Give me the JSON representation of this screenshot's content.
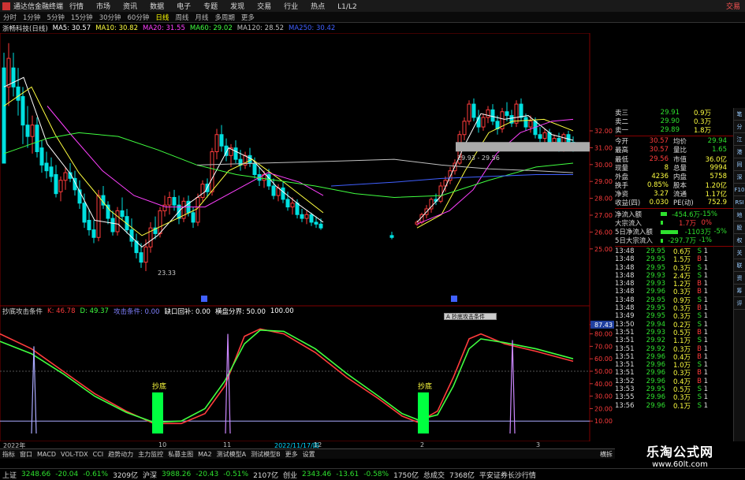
{
  "titlebar": {
    "app_name": "通达信金融终端",
    "menu": [
      "行情",
      "市场",
      "资讯",
      "数据",
      "电子",
      "专题",
      "发现",
      "交易",
      "行业",
      "热点",
      "L1/L2"
    ],
    "right_text": "交易"
  },
  "periodbar": {
    "items": [
      "分时",
      "1分钟",
      "5分钟",
      "15分钟",
      "30分钟",
      "60分钟",
      "日线",
      "周线",
      "月线",
      "多周期",
      "更多"
    ],
    "active": "日线"
  },
  "ma_legend": {
    "stock": "浙畅科技(日线)",
    "items": [
      {
        "text": "MA5: 30.57",
        "color": "#ffffff"
      },
      {
        "text": "MA10: 30.82",
        "color": "#ffff40"
      },
      {
        "text": "MA20: 31.55",
        "color": "#ff40ff"
      },
      {
        "text": "MA60: 29.02",
        "color": "#40ff40"
      },
      {
        "text": "MA120: 28.52",
        "color": "#c0c0c0"
      },
      {
        "text": "MA250: 30.42",
        "color": "#4060ff"
      }
    ]
  },
  "price_axis": [
    "32.00",
    "31.00",
    "30.00",
    "29.00",
    "28.00",
    "27.00",
    "26.00",
    "25.00"
  ],
  "price_labels": {
    "low": "23.33",
    "range": "29.93 - 29.56"
  },
  "ind_legend": {
    "name": "抄底攻击条件",
    "items": [
      {
        "text": "K: 46.78",
        "color": "#ff3c3c"
      },
      {
        "text": "D: 49.37",
        "color": "#40ff40"
      },
      {
        "text": "攻击条件: 0.00",
        "color": "#8080ff"
      },
      {
        "text": "缺口回补: 0.00",
        "color": "#ffffff"
      },
      {
        "text": "横盘分界: 50.00",
        "color": "#ffffff"
      },
      {
        "text": "100.00",
        "color": "#ffffff"
      }
    ]
  },
  "indicator_axis": [
    "87.43",
    "80.00",
    "70.00",
    "60.00",
    "50.00",
    "40.00",
    "30.00",
    "20.00",
    "10.00"
  ],
  "signal_label": "抄底",
  "popup_text": "A 抄底攻击条件",
  "xaxis": [
    "2022年",
    "10",
    "11",
    "2022/11/17/四",
    "12",
    "2",
    "3"
  ],
  "quote": {
    "asks": [
      [
        "卖三",
        "29.91",
        "0.9万"
      ],
      [
        "卖二",
        "29.90",
        "0.3万"
      ],
      [
        "卖一",
        "29.89",
        "1.8万"
      ]
    ],
    "stats": [
      [
        "今开",
        "30.57",
        "均价",
        "29.94"
      ],
      [
        "最高",
        "30.57",
        "量比",
        "1.65"
      ],
      [
        "最低",
        "29.56",
        "市值",
        "36.0亿"
      ],
      [
        "现量",
        "8",
        "总量",
        "9994"
      ],
      [
        "外盘",
        "4236",
        "内盘",
        "5758"
      ],
      [
        "换手",
        "0.85%",
        "股本",
        "1.20亿"
      ],
      [
        "净资",
        "3.27",
        "流通",
        "1.17亿"
      ],
      [
        "收益(四)",
        "0.030",
        "PE(动)",
        "752.9"
      ]
    ],
    "flows": [
      [
        "净流入额",
        "-454.6万",
        "-15%"
      ],
      [
        "大宗流入",
        "1.7万",
        "0%"
      ],
      [
        "5日净流入额",
        "-1103万",
        "-5%"
      ],
      [
        "5日大宗流入",
        "-297.7万",
        "-1%"
      ]
    ],
    "ticks": [
      [
        "13:48",
        "29.95",
        "0.6万",
        "S",
        "1"
      ],
      [
        "13:48",
        "29.95",
        "1.5万",
        "B",
        "1"
      ],
      [
        "13:48",
        "29.95",
        "0.3万",
        "S",
        "1"
      ],
      [
        "13:48",
        "29.93",
        "2.4万",
        "S",
        "1"
      ],
      [
        "13:48",
        "29.93",
        "1.2万",
        "B",
        "1"
      ],
      [
        "13:48",
        "29.96",
        "0.3万",
        "B",
        "1"
      ],
      [
        "13:48",
        "29.95",
        "0.9万",
        "S",
        "1"
      ],
      [
        "13:48",
        "29.95",
        "0.3万",
        "B",
        "1"
      ],
      [
        "13:49",
        "29.95",
        "0.3万",
        "S",
        "1"
      ],
      [
        "13:50",
        "29.94",
        "0.2万",
        "S",
        "1"
      ],
      [
        "13:51",
        "29.93",
        "0.5万",
        "B",
        "1"
      ],
      [
        "13:51",
        "29.92",
        "1.1万",
        "S",
        "1"
      ],
      [
        "13:51",
        "29.92",
        "0.3万",
        "B",
        "1"
      ],
      [
        "13:51",
        "29.96",
        "0.4万",
        "B",
        "1"
      ],
      [
        "13:51",
        "29.96",
        "1.0万",
        "S",
        "1"
      ],
      [
        "13:51",
        "29.96",
        "0.3万",
        "B",
        "1"
      ],
      [
        "13:52",
        "29.96",
        "0.4万",
        "B",
        "1"
      ],
      [
        "13:53",
        "29.95",
        "0.5万",
        "S",
        "1"
      ],
      [
        "13:55",
        "29.96",
        "0.3万",
        "S",
        "1"
      ],
      [
        "13:56",
        "29.96",
        "0.1万",
        "S",
        "1"
      ]
    ]
  },
  "side_tabs": [
    "笔",
    "分",
    "江",
    "港",
    "同",
    "深",
    "F10",
    "RSI",
    "地",
    "股",
    "权",
    "关",
    "联",
    "资",
    "筹",
    "评"
  ],
  "bottom_tabs": {
    "items": [
      "指标",
      "窗口",
      "MACD",
      "VOL-TDX",
      "CCI",
      "趋势动力",
      "主力监控",
      "私募主图",
      "MA2",
      "测试模型A",
      "测试模型B",
      "更多",
      "设置"
    ],
    "mode": "横拆"
  },
  "statusbar": [
    {
      "text": "上证",
      "color": "#ddd"
    },
    {
      "text": "3248.66",
      "color": "#2ee02e"
    },
    {
      "text": "-20.04",
      "color": "#2ee02e"
    },
    {
      "text": "-0.61%",
      "color": "#2ee02e"
    },
    {
      "text": "3209亿",
      "color": "#ddd"
    },
    {
      "text": "沪深",
      "color": "#ddd"
    },
    {
      "text": "3988.26",
      "color": "#2ee02e"
    },
    {
      "text": "-20.43",
      "color": "#2ee02e"
    },
    {
      "text": "-0.51%",
      "color": "#2ee02e"
    },
    {
      "text": "2107亿",
      "color": "#ddd"
    },
    {
      "text": "创业",
      "color": "#ddd"
    },
    {
      "text": "2343.46",
      "color": "#2ee02e"
    },
    {
      "text": "-13.61",
      "color": "#2ee02e"
    },
    {
      "text": "-0.58%",
      "color": "#2ee02e"
    },
    {
      "text": "1750亿",
      "color": "#ddd"
    },
    {
      "text": "总成交",
      "color": "#ddd"
    },
    {
      "text": "7368亿",
      "color": "#ddd"
    },
    {
      "text": "平安证券长沙行情",
      "color": "#ddd"
    }
  ],
  "watermark": {
    "big": "乐淘公式网",
    "url": "www.60lt.com"
  },
  "colors": {
    "up": "#ff3c3c",
    "down": "#00e0e0",
    "k": "#ff3c3c",
    "d": "#40ff40",
    "ma5": "#ffffff",
    "ma10": "#ffff40",
    "ma20": "#ff40ff",
    "ma60": "#40ff40",
    "ma120": "#c0c0c0",
    "ma250": "#4060ff",
    "signal": "#00ff40"
  }
}
